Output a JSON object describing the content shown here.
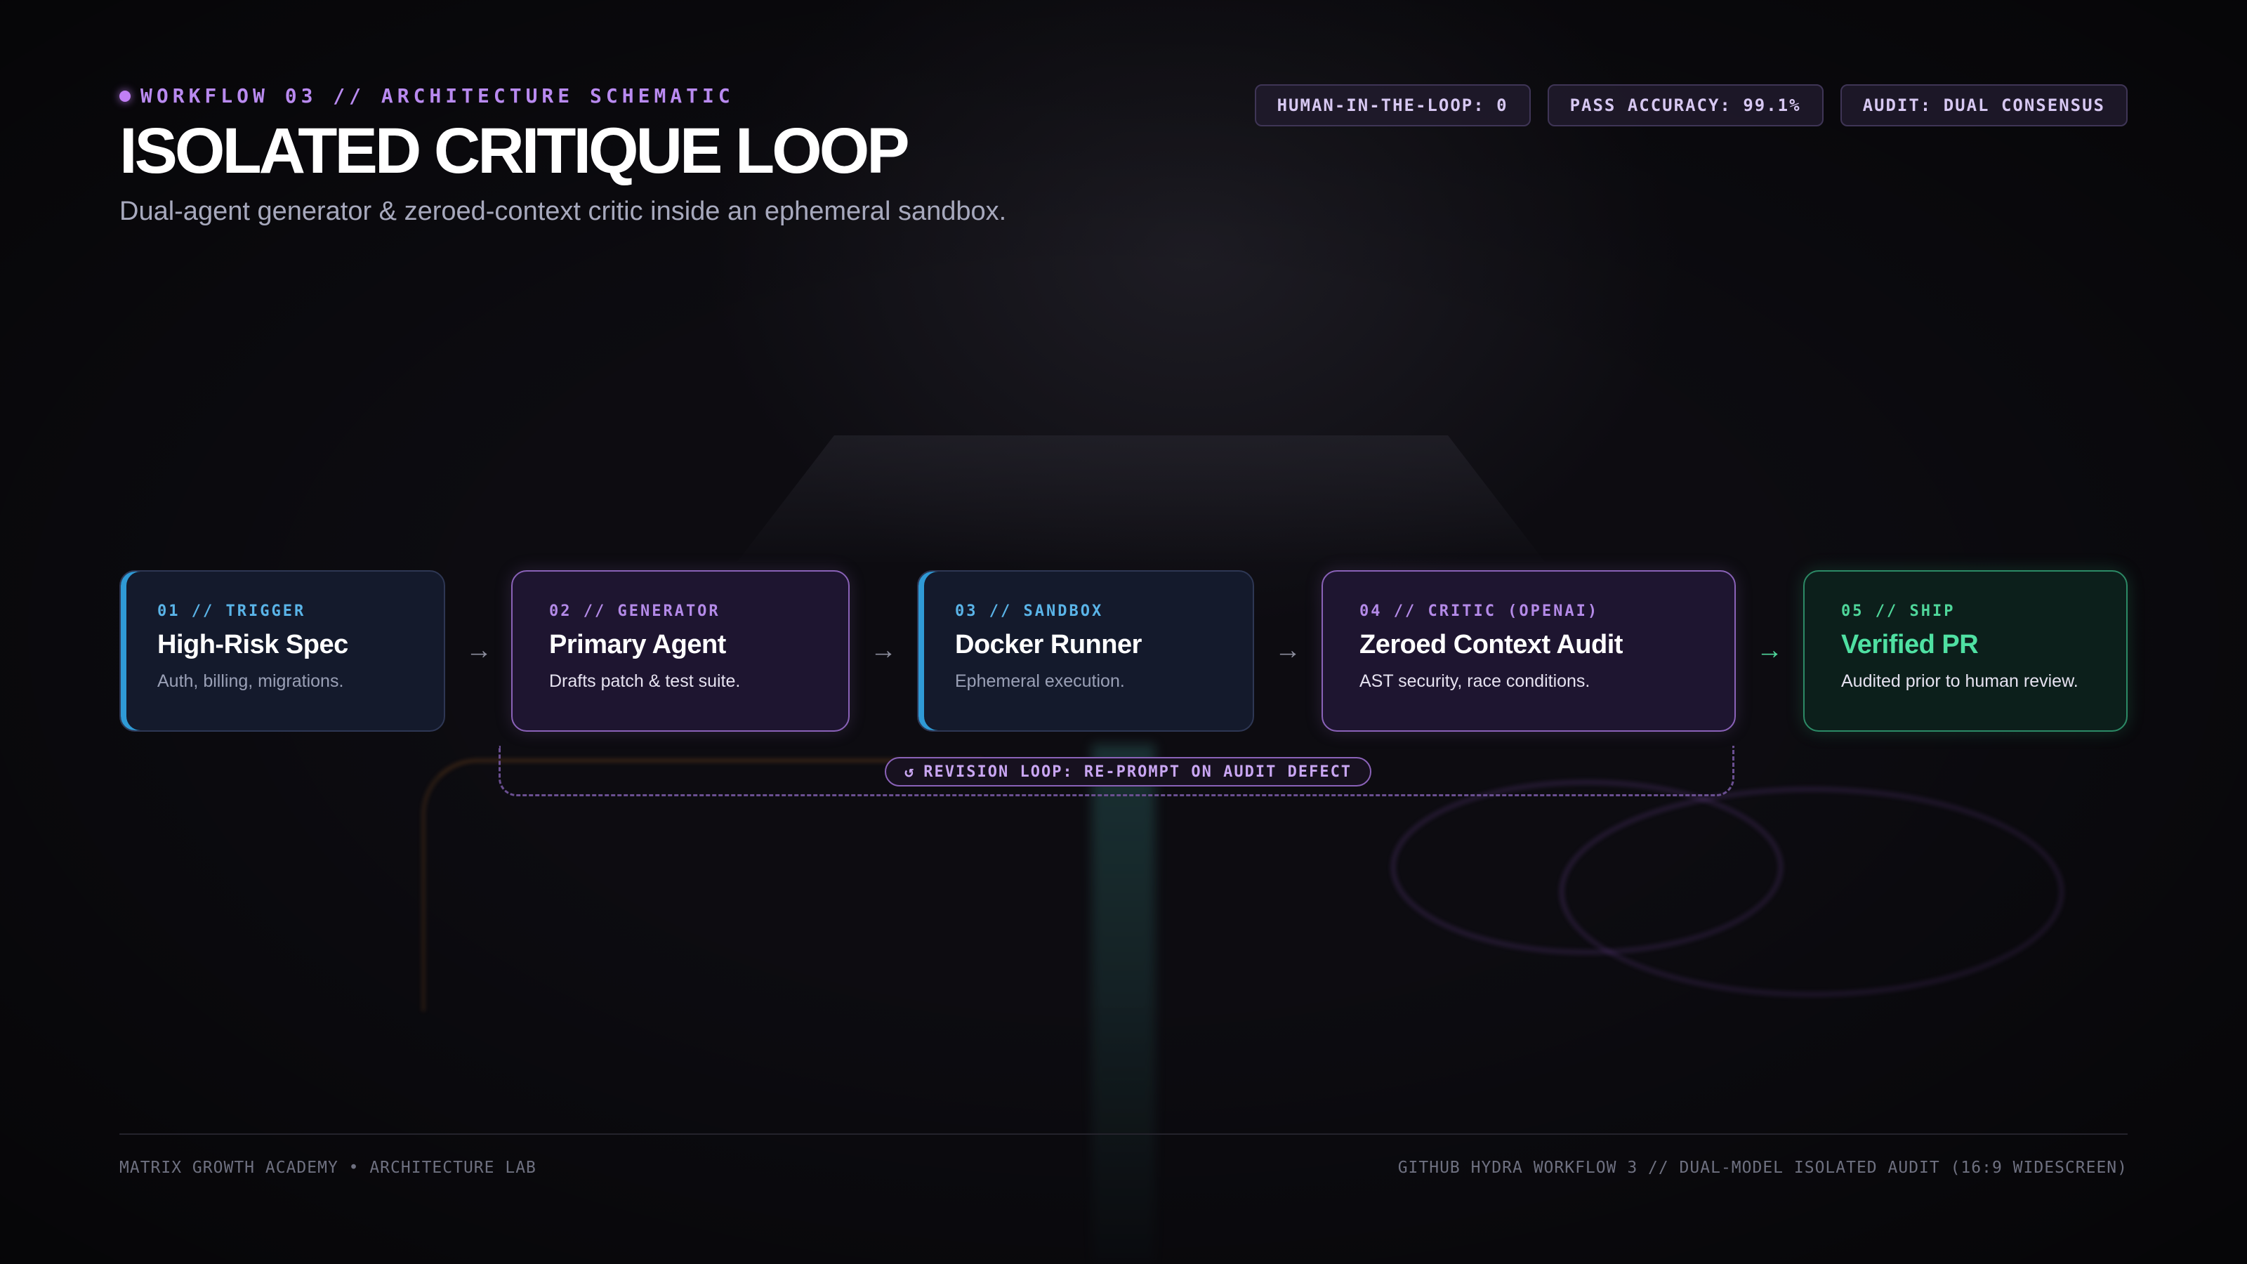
{
  "header": {
    "eyebrow": "WORKFLOW 03 // ARCHITECTURE SCHEMATIC",
    "title": "ISOLATED CRITIQUE LOOP",
    "subtitle": "Dual-agent generator & zeroed-context critic inside an ephemeral sandbox."
  },
  "badges": [
    "HUMAN-IN-THE-LOOP: 0",
    "PASS ACCURACY: 99.1%",
    "AUDIT: DUAL CONSENSUS"
  ],
  "steps": [
    {
      "label": "01 // TRIGGER",
      "title": "High-Risk Spec",
      "description": "Auth, billing, migrations.",
      "theme": "blue"
    },
    {
      "label": "02 // GENERATOR",
      "title": "Primary Agent",
      "description": "Drafts patch & test suite.",
      "theme": "purple"
    },
    {
      "label": "03 // SANDBOX",
      "title": "Docker Runner",
      "description": "Ephemeral execution.",
      "theme": "blue"
    },
    {
      "label": "04 // CRITIC (OPENAI)",
      "title": "Zeroed Context Audit",
      "description": "AST security, race conditions.",
      "theme": "purple"
    },
    {
      "label": "05 // SHIP",
      "title": "Verified PR",
      "description": "Audited prior to human review.",
      "theme": "green"
    }
  ],
  "arrow_icon": "arrow-right-icon",
  "loop": {
    "icon": "refresh-icon",
    "icon_glyph": "↺",
    "label": "REVISION LOOP: RE-PROMPT ON AUDIT DEFECT"
  },
  "footer": {
    "left": "MATRIX GROWTH ACADEMY • ARCHITECTURE LAB",
    "right": "GITHUB HYDRA WORKFLOW 3 // DUAL-MODEL ISOLATED AUDIT (16:9 WIDESCREEN)"
  },
  "colors": {
    "background": "#0d0c11",
    "accent_purple": "#b98af0",
    "accent_blue": "#5ab4e8",
    "accent_green": "#4fd69a"
  }
}
